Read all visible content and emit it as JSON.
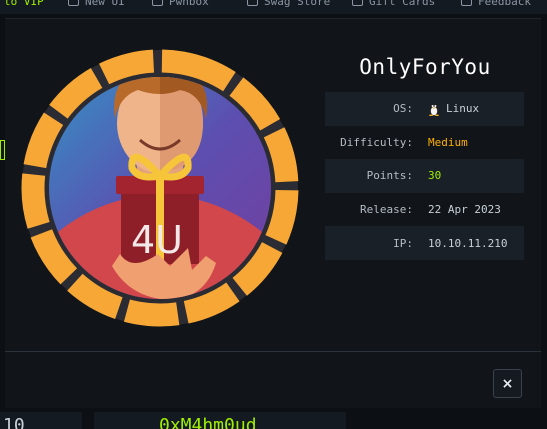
{
  "background": {
    "nav_items": [
      {
        "label": "to VIP",
        "accent": true
      },
      {
        "label": "New UI",
        "icon": "new-ui-icon"
      },
      {
        "label": "Pwnbox",
        "icon": "pwnbox-icon"
      },
      {
        "label": "Swag Store",
        "icon": "store-icon"
      },
      {
        "label": "Gift Cards",
        "icon": "gift-icon"
      },
      {
        "label": "Feedback",
        "icon": "feedback-icon"
      }
    ],
    "bottom_left": "10",
    "bottom_user": "0xM4hm0ud"
  },
  "machine": {
    "name": "OnlyForYou",
    "avatar_text": "4U",
    "os_label": "OS:",
    "os_value": "Linux",
    "os_icon": "linux-penguin-icon",
    "difficulty_label": "Difficulty:",
    "difficulty_value": "Medium",
    "points_label": "Points:",
    "points_value": "30",
    "release_label": "Release:",
    "release_value": "22 Apr 2023",
    "ip_label": "IP:",
    "ip_value": "10.10.11.210"
  },
  "modal": {
    "close_label": "×",
    "close_icon": "close-icon"
  },
  "colors": {
    "accent_green": "#9fef00",
    "difficulty_orange": "#ffaf00",
    "ring_orange": "#f7a735",
    "modal_bg": "#111519"
  }
}
